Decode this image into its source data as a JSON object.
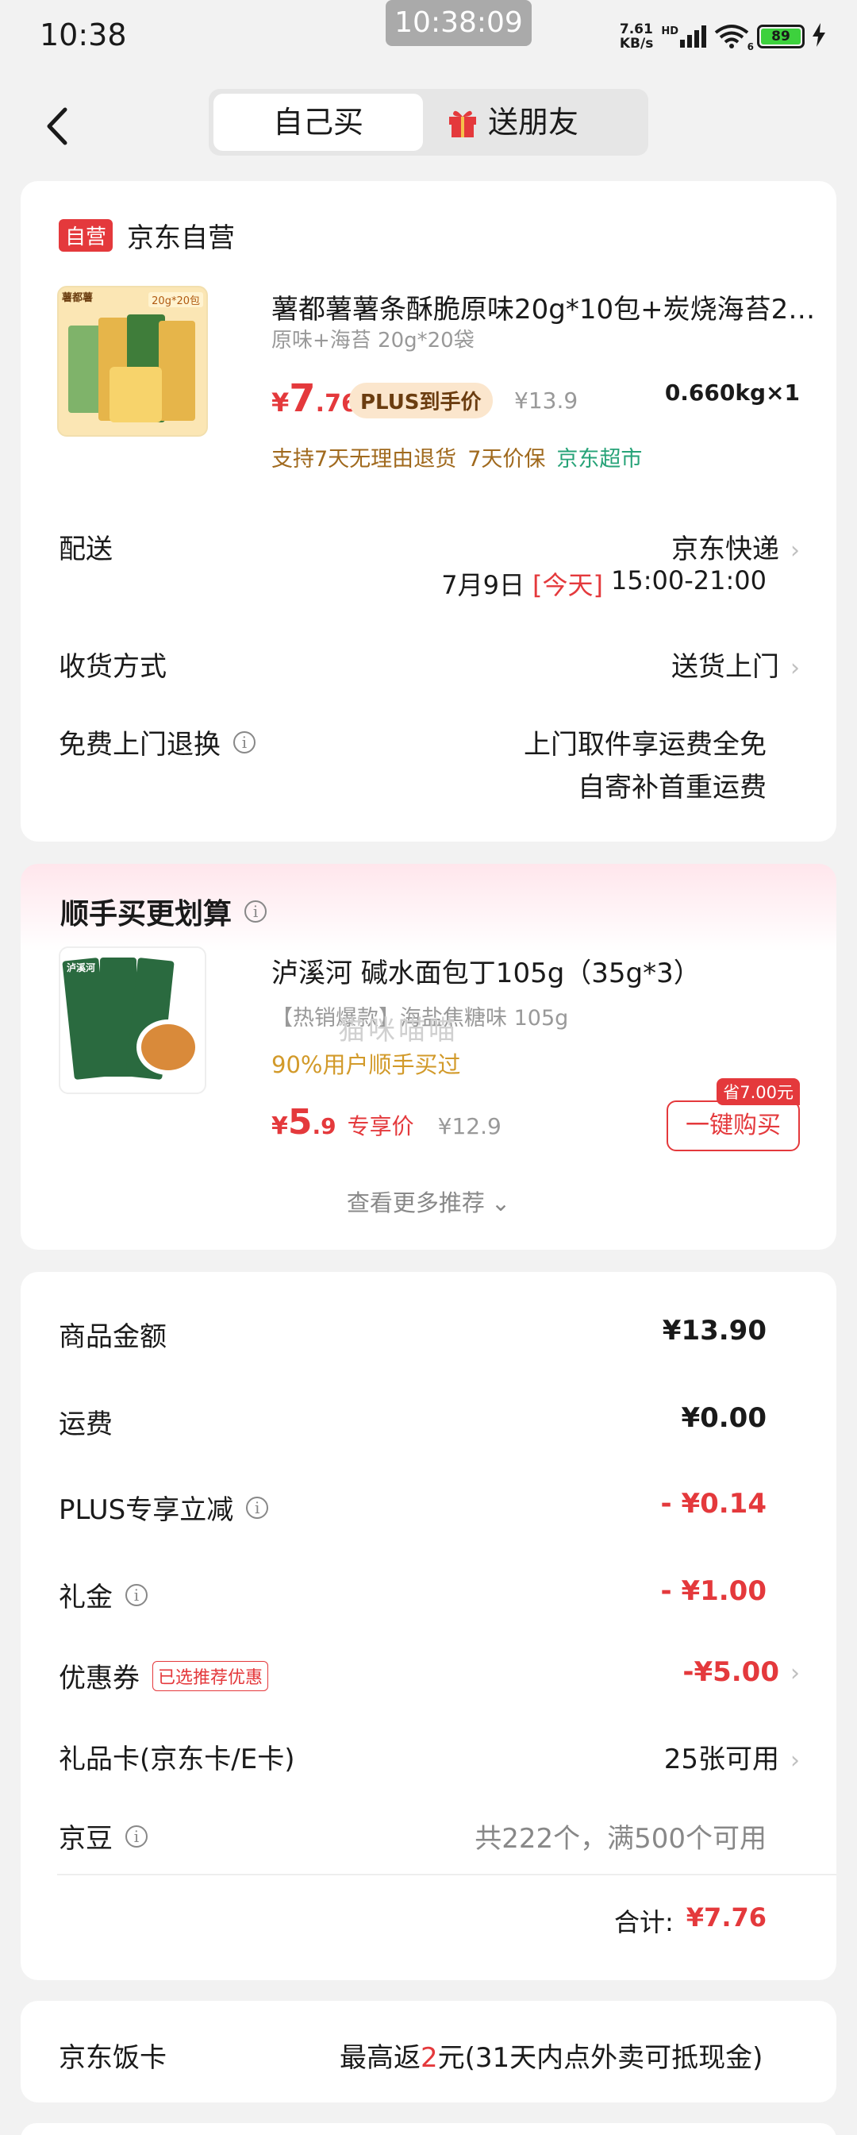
{
  "status_bar": {
    "time": "10:38",
    "center_time": "10:38:09",
    "speed_value": "7.61",
    "speed_unit": "KB/s",
    "network": "HD",
    "wifi_badge": "6",
    "battery": "89"
  },
  "nav": {
    "tab_self": "自己买",
    "tab_friend": "送朋友"
  },
  "order": {
    "self_tag": "自营",
    "shop_name": "京东自营",
    "thumb_badge": "20g*20包",
    "thumb_brand": "薯都薯",
    "title": "薯都薯薯条酥脆原味20g*10包+炭烧海苔2…",
    "spec": "原味+海苔 20g*20袋",
    "price_symbol": "¥",
    "price_int": "7",
    "price_dec": ".76",
    "plus_label": "PLUS到手价",
    "orig_price": "¥13.9",
    "weight_qty": "0.660kg×1",
    "service_return": "支持7天无理由退货",
    "service_price": "7天价保",
    "service_market": "京东超市",
    "delivery_label": "配送",
    "delivery_method": "京东快递",
    "delivery_date": "7月9日",
    "delivery_today": "[今天]",
    "delivery_time": "15:00-21:00",
    "receive_label": "收货方式",
    "receive_value": "送货上门",
    "return_label": "免费上门退换",
    "return_line1": "上门取件享运费全免",
    "return_line2": "自寄补首重运费"
  },
  "addon": {
    "title": "顺手买更划算",
    "thumb_brand": "泸溪河",
    "product_name": "泸溪河 碱水面包丁105g（35g*3）",
    "tagline": "【热销爆款】海盐焦糖味 105g",
    "watermark": "猫咪喵喵",
    "buy_stat": "90%用户顺手买过",
    "price_symbol": "¥",
    "price_int": "5",
    "price_dec": ".9",
    "price_label": "专享价",
    "orig_price": "¥12.9",
    "save_badge": "省7.00元",
    "buy_button": "一键购买",
    "more": "查看更多推荐"
  },
  "summary": {
    "goods_label": "商品金额",
    "goods_value": "¥13.90",
    "ship_label": "运费",
    "ship_value": "¥0.00",
    "plus_label": "PLUS专享立减",
    "plus_value": "- ¥0.14",
    "gift_label": "礼金",
    "gift_value": "- ¥1.00",
    "coupon_label": "优惠券",
    "coupon_tag": "已选推荐优惠",
    "coupon_value": "-¥5.00",
    "card_label": "礼品卡(京东卡/E卡)",
    "card_value": "25张可用",
    "bean_label": "京豆",
    "bean_value": "共222个，满500个可用",
    "total_label": "合计:",
    "total_value": "¥7.76"
  },
  "meal_card": {
    "label": "京东饭卡",
    "prefix": "最高返",
    "amount": "2",
    "suffix": "元(31天内点外卖可抵现金)"
  },
  "colors": {
    "brand_red": "#e4393c",
    "plus_gold": "#a0691d",
    "jd_green": "#27a378",
    "battery_green": "#3dd13d"
  }
}
